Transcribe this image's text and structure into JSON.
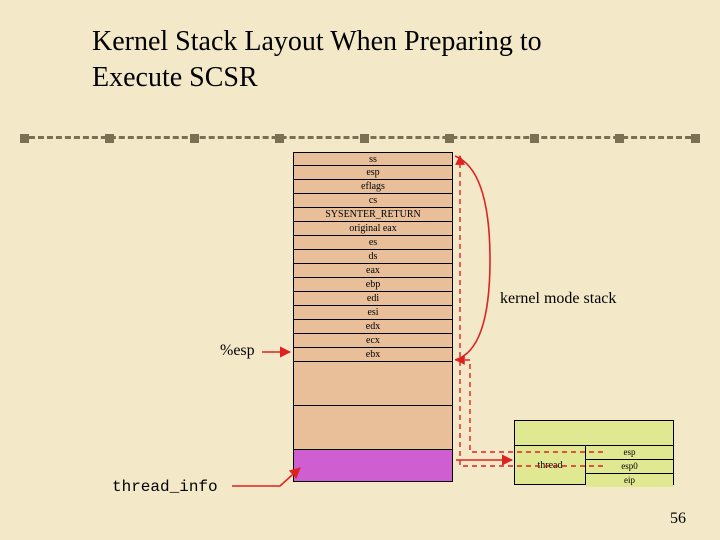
{
  "title_line1": "Kernel Stack Layout When Preparing to",
  "title_line2": "Execute SCSR",
  "stack_rows": [
    "ss",
    "esp",
    "eflags",
    "cs",
    "SYSENTER_RETURN",
    "original eax",
    "es",
    "ds",
    "eax",
    "ebp",
    "edi",
    "esi",
    "edx",
    "ecx",
    "ebx"
  ],
  "esp_label": "%esp",
  "thread_info_label": "thread_info",
  "kernel_mode_stack_label": "kernel mode stack",
  "small_table": {
    "thread_label": "thread",
    "rows": [
      "esp",
      "esp0",
      "eip"
    ]
  },
  "page_number": "56"
}
